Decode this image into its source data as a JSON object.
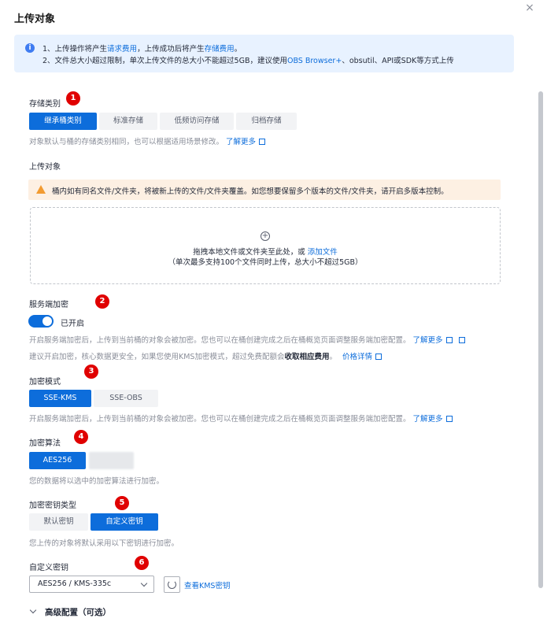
{
  "dialog": {
    "title": "上传对象",
    "close_symbol": "×"
  },
  "info": {
    "line1_prefix": "1、上传操作将产生",
    "line1_link1": "请求费用",
    "line1_mid": "，上传成功后将产生",
    "line1_link2": "存储费用",
    "line1_suffix": "。",
    "line2_prefix": "2、文件总大小超过限制，单次上传文件的总大小不能超过5GB，建议使用",
    "line2_link": "OBS Browser+",
    "line2_suffix": "、obsutil、API或SDK等方式上传"
  },
  "storage_class": {
    "label": "存储类别",
    "options": [
      "继承桶类别",
      "标准存储",
      "低频访问存储",
      "归档存储"
    ],
    "selected": "继承桶类别",
    "hint": "对象默认与桶的存储类别相同，也可以根据适用场景修改。",
    "hint_link": "了解更多"
  },
  "upload": {
    "label": "上传对象",
    "warning": "桶内如有同名文件/文件夹，将被新上传的文件/文件夹覆盖。如您想要保留多个版本的文件/文件夹，请开启多版本控制。",
    "drop_text": "拖拽本地文件或文件夹至此处，或 ",
    "drop_link": "添加文件",
    "drop_limit": "（单次最多支持100个文件同时上传，总大小不超过5GB）"
  },
  "encryption": {
    "label": "服务端加密",
    "toggle_text": "已开启",
    "hint1": "开启服务端加密后，上传到当前桶的对象会被加密。您也可以在桶创建完成之后在桶概览页面调整服务端加密配置。",
    "hint1_link": "了解更多",
    "hint2_prefix": "建议开启加密，核心数据更安全，如果您使用KMS加密模式，超过免费配额会",
    "hint2_bold": "收取相应费用",
    "hint2_suffix": "。",
    "hint2_link": "价格详情"
  },
  "encryption_mode": {
    "label": "加密模式",
    "options": [
      "SSE-KMS",
      "SSE-OBS"
    ],
    "selected": "SSE-KMS",
    "hint": "开启服务端加密后，上传到当前桶的对象会被加密。您也可以在桶创建完成之后在桶概览页面调整服务端加密配置。",
    "hint_link": "了解更多"
  },
  "algorithm": {
    "label": "加密算法",
    "options": [
      "AES256"
    ],
    "selected": "AES256",
    "hint": "您的数据将以选中的加密算法进行加密。"
  },
  "key_type": {
    "label": "加密密钥类型",
    "options": [
      "默认密钥",
      "自定义密钥"
    ],
    "selected": "自定义密钥",
    "hint": "您上传的对象将默认采用以下密钥进行加密。"
  },
  "custom_key": {
    "label": "自定义密钥",
    "value": "AES256 / KMS-335c",
    "view_link": "查看KMS密钥"
  },
  "advanced": {
    "label": "高级配置（可选）"
  },
  "markers": [
    "1",
    "2",
    "3",
    "4",
    "5",
    "6"
  ],
  "colors": {
    "primary": "#0d6ddb",
    "marker": "#e00000",
    "info_bg": "#e8f2ff",
    "warn_bg": "#fdf0e3"
  }
}
